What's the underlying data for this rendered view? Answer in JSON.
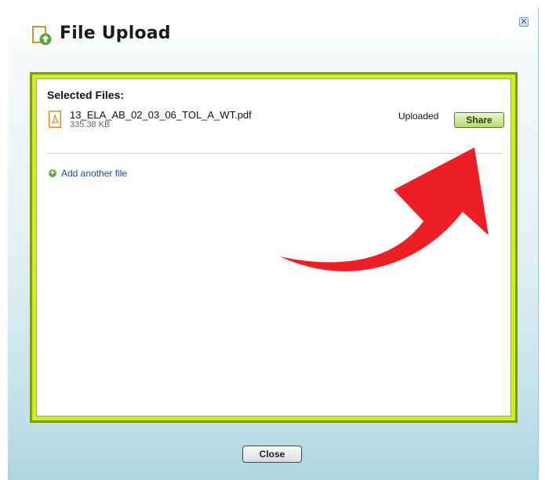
{
  "dialog": {
    "title": "File Upload",
    "close_x_label": "✕",
    "close_button_label": "Close"
  },
  "files": {
    "heading": "Selected Files:",
    "items": [
      {
        "name": "13_ELA_AB_02_03_06_TOL_A_WT.pdf",
        "size": "335.38 KB",
        "status": "Uploaded",
        "action_label": "Share",
        "icon": "pdf-icon"
      }
    ],
    "add_label": "Add another file",
    "add_icon": "+"
  },
  "colors": {
    "frame_lime": "#ccf01a",
    "frame_olive": "#7f9a10",
    "share_button": "#b9d97a",
    "arrow": "#ec1f27",
    "link": "#1c4b8a"
  },
  "icons": {
    "title": "upload-file-icon",
    "add": "add-circle-icon",
    "close": "close-icon",
    "annotation": "curved-arrow-icon"
  }
}
